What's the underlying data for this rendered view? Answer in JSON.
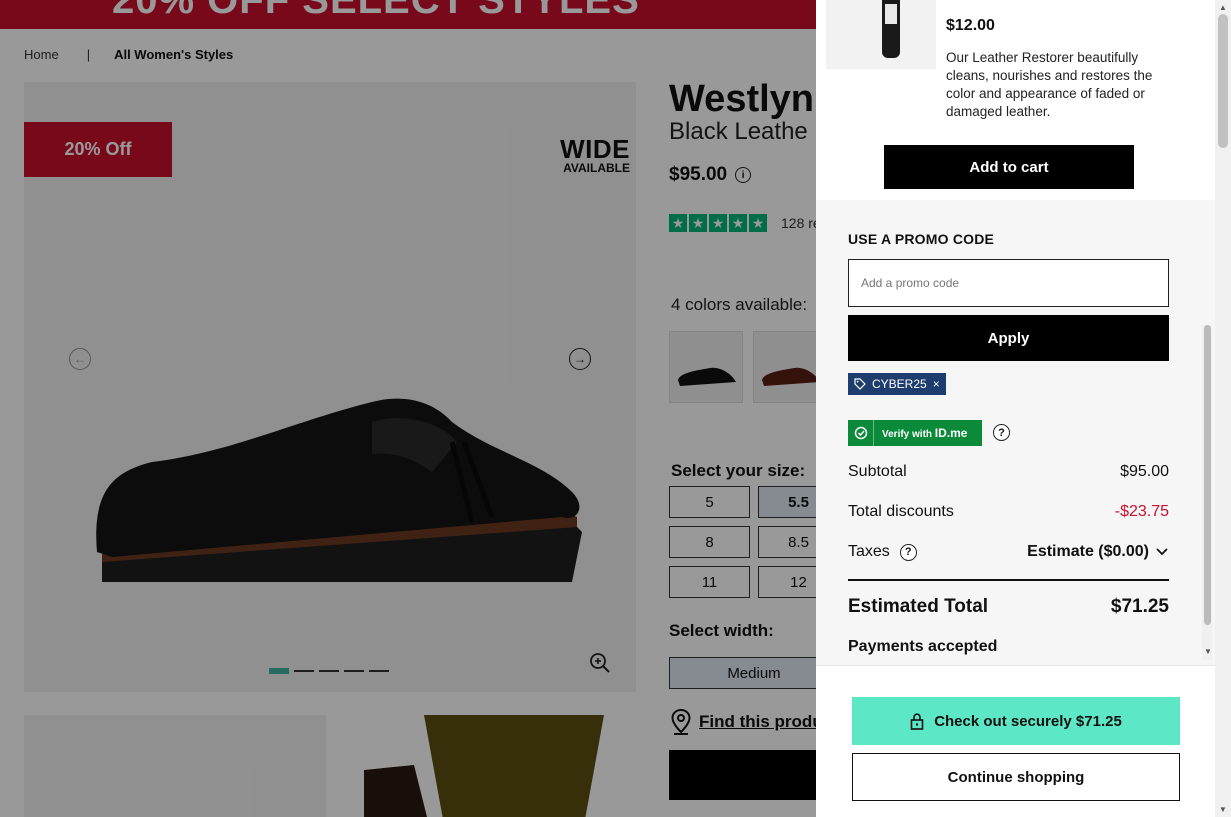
{
  "promo_banner": {
    "text": "20% OFF SELECT STYLES"
  },
  "breadcrumb": {
    "home": "Home",
    "separator": "|",
    "current": "All Women's Styles"
  },
  "gallery": {
    "discount_badge": "20% Off",
    "wide_line1": "WIDE",
    "wide_line2": "AVAILABLE",
    "active_slide": 1,
    "slide_count": 5
  },
  "product": {
    "title": "Westlyn",
    "subtitle": "Black Leathe",
    "price": "$95.00",
    "reviews": "128 re",
    "colors_label": "4 colors available:",
    "size_label": "Select your size:",
    "sizes": [
      "5",
      "5.5",
      "8",
      "8.5",
      "11",
      "12"
    ],
    "selected_size": "5.5",
    "width_label": "Select width:",
    "width_value": "Medium",
    "find_store": "Find this produ"
  },
  "drawer": {
    "recommended": {
      "price": "$12.00",
      "description": "Our Leather Restorer beautifully cleans, nourishes and restores the color and appearance of faded or damaged leather.",
      "add_to_cart": "Add to cart"
    },
    "promo": {
      "title": "USE A PROMO CODE",
      "placeholder": "Add a promo code",
      "apply": "Apply",
      "applied_code": "CYBER25"
    },
    "verify": {
      "label": "Verify with",
      "brand": "ID.me"
    },
    "summary": {
      "subtotal_label": "Subtotal",
      "subtotal_value": "$95.00",
      "discount_label": "Total discounts",
      "discount_value": "-$23.75",
      "taxes_label": "Taxes",
      "taxes_value": "Estimate ($0.00)",
      "total_label": "Estimated Total",
      "total_value": "$71.25",
      "payments_label": "Payments accepted"
    },
    "checkout": "Check out securely $71.25",
    "continue": "Continue shopping"
  },
  "colors": {
    "brand_red": "#c8102e",
    "checkout_teal": "#5ce8c6",
    "trustpilot_green": "#00b67a",
    "coupon_navy": "#1c3d6e",
    "idme_green": "#0b8a3a"
  }
}
